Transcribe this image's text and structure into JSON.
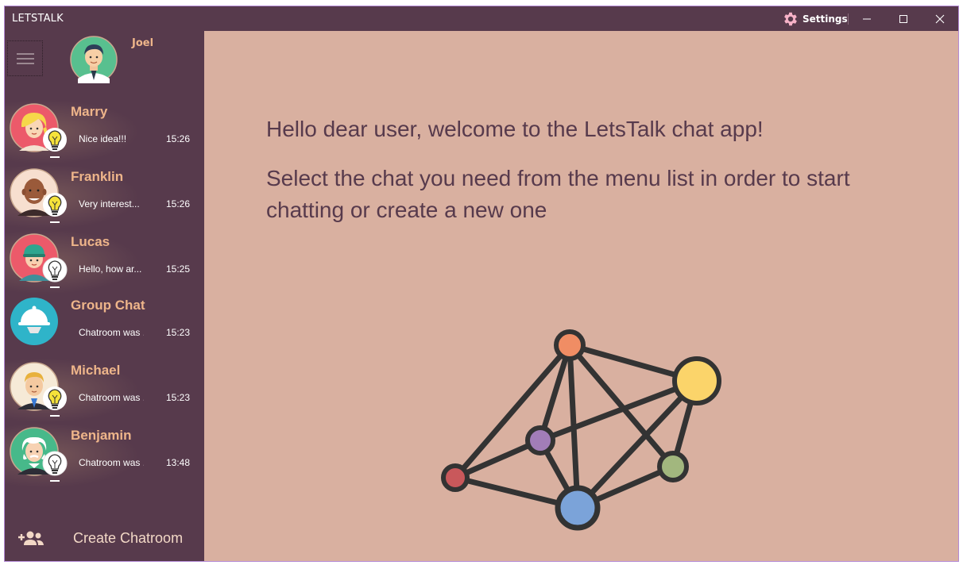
{
  "window": {
    "title": "LETSTALK",
    "settings_label": "Settings"
  },
  "user": {
    "name": "Joel",
    "avatar_icon": "man-avatar"
  },
  "chats": [
    {
      "name": "Marry",
      "preview": "Nice idea!!!",
      "time": "15:26",
      "status": "bulb-on",
      "avatar_icon": "woman-blonde-avatar"
    },
    {
      "name": "Franklin",
      "preview": "Very interest...",
      "time": "15:26",
      "status": "bulb-on",
      "avatar_icon": "man-bald-avatar"
    },
    {
      "name": "Lucas",
      "preview": "Hello, how ar...",
      "time": "15:25",
      "status": "bulb-off",
      "avatar_icon": "boy-cap-avatar"
    },
    {
      "name": "Group Chat",
      "preview": "Chatroom was ...",
      "time": "15:23",
      "status": "none",
      "avatar_icon": "group-tray-avatar"
    },
    {
      "name": "Michael",
      "preview": "Chatroom was ...",
      "time": "15:23",
      "status": "bulb-on",
      "avatar_icon": "man-suit-avatar"
    },
    {
      "name": "Benjamin",
      "preview": "Chatroom was ...",
      "time": "13:48",
      "status": "bulb-off",
      "avatar_icon": "old-man-avatar"
    }
  ],
  "create": {
    "label": "Create Chatroom",
    "icon": "add-users-icon"
  },
  "main": {
    "welcome_line": "Hello dear user, welcome to the LetsTalk chat app!",
    "instruction_line": "Select the chat you need from the menu list in order to start chatting or create a new one",
    "illustration_icon": "network-graph"
  },
  "colors": {
    "title_bg": "#573a4c",
    "sidebar_bg": "#573a4c",
    "main_bg": "#d9b0a0",
    "accent_text": "#eeb58a",
    "heading_text": "#573a4c",
    "bulb_on": "#f5e23a",
    "bulb_off": "#ffffff"
  }
}
